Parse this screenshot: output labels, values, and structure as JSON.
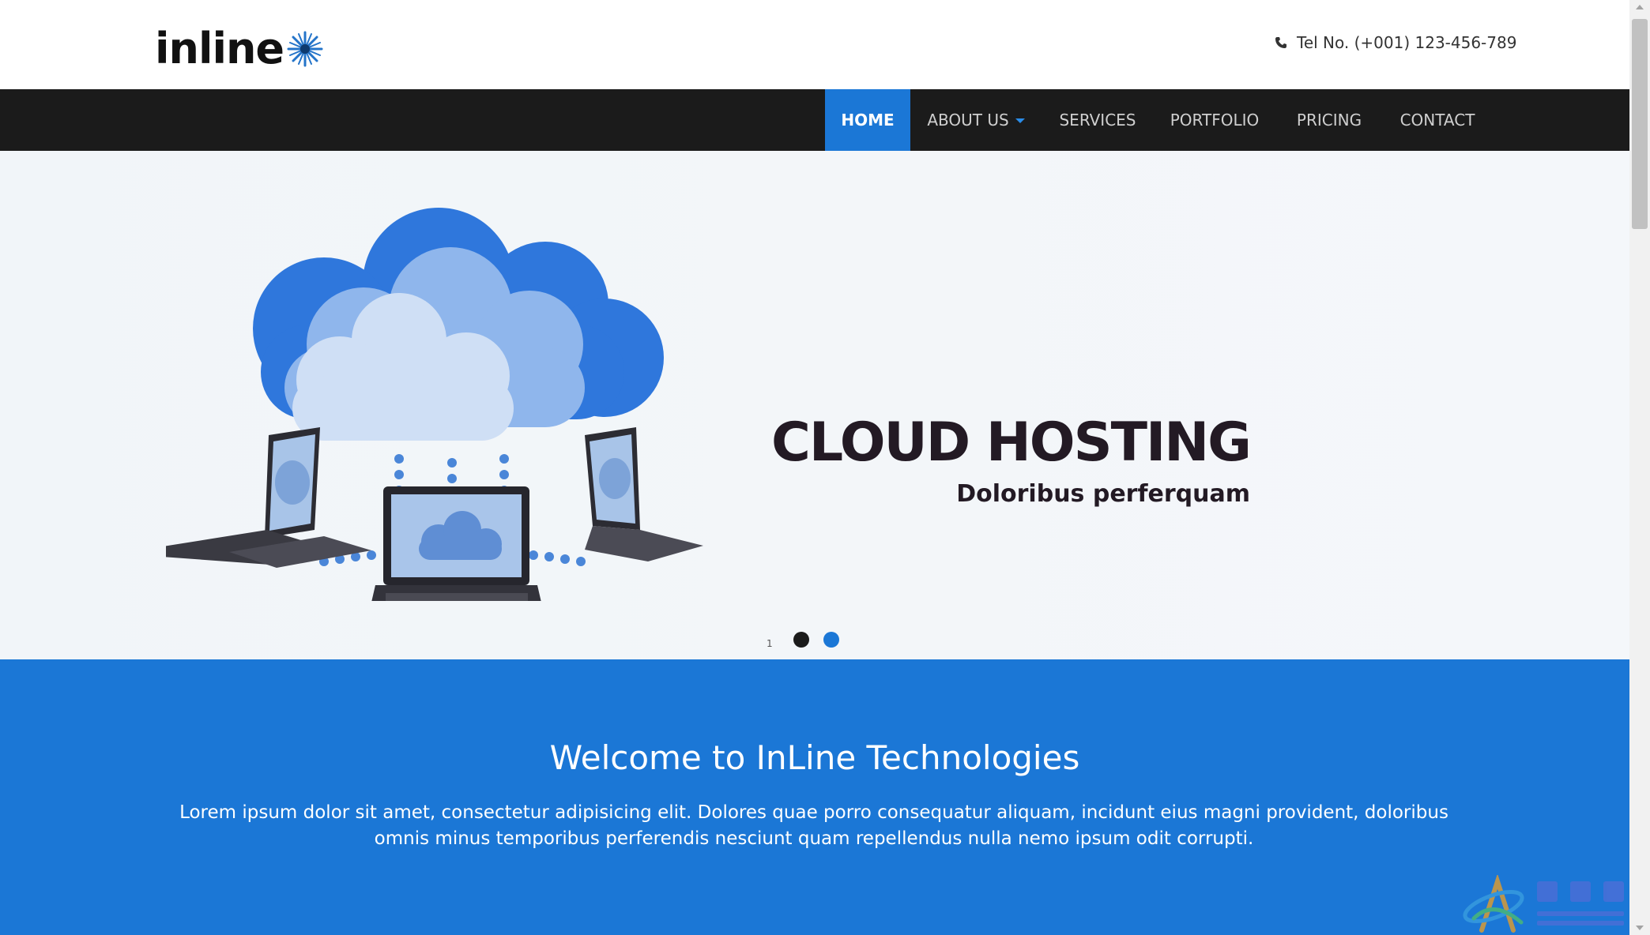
{
  "header": {
    "logo_text": "inline",
    "tel": "Tel No. (+001) 123-456-789"
  },
  "nav": {
    "items": [
      {
        "label": "HOME",
        "active": true
      },
      {
        "label": "ABOUT US",
        "active": false,
        "dropdown": true
      },
      {
        "label": "SERVICES",
        "active": false
      },
      {
        "label": "PORTFOLIO",
        "active": false
      },
      {
        "label": "PRICING",
        "active": false
      },
      {
        "label": "CONTACT",
        "active": false
      }
    ]
  },
  "hero": {
    "title": "CLOUD HOSTING",
    "subtitle": "Doloribus perferquam",
    "slide_number": "1"
  },
  "welcome": {
    "title": "Welcome to InLine Technologies",
    "text": "Lorem ipsum dolor sit amet, consectetur adipisicing elit. Dolores quae porro consequatur aliquam, incidunt eius magni provident, doloribus omnis minus temporibus perferendis nesciunt quam repellendus nulla nemo ipsum odit corrupti."
  },
  "colors": {
    "accent": "#1b77d6",
    "nav_bg": "#1b1b1b",
    "hero_text": "#231a24",
    "dot_dark": "#1b1b1b"
  },
  "icons": {
    "phone": "phone-icon",
    "logo_star": "star-burst-icon",
    "dropdown": "caret-down-icon"
  }
}
